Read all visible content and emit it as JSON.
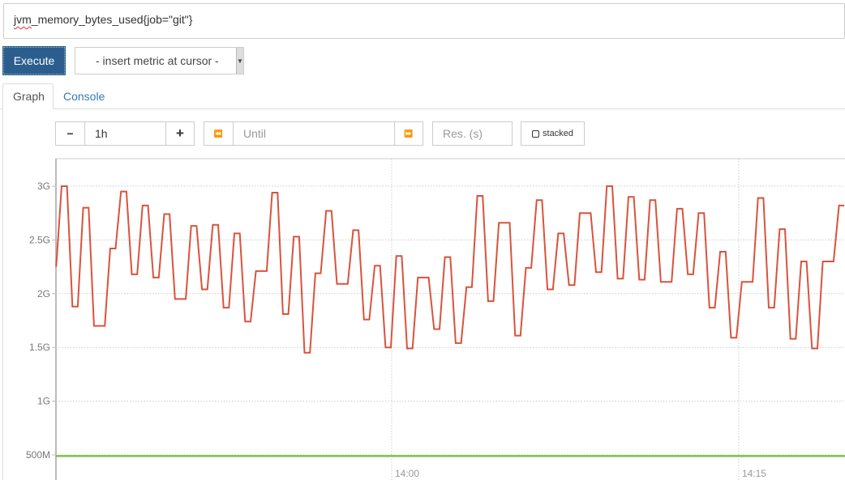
{
  "query": {
    "prefix": "jvm",
    "rest": "_memory_bytes_used{job=\"git\"}"
  },
  "toolbar": {
    "execute_label": "Execute",
    "metric_select": "- insert metric at cursor -"
  },
  "tabs": [
    {
      "label": "Graph",
      "active": true
    },
    {
      "label": "Console",
      "active": false
    }
  ],
  "controls": {
    "minus": "−",
    "range": "1h",
    "plus": "+",
    "rewind_icon": "⏪",
    "until_placeholder": "Until",
    "forward_icon": "⏩",
    "res_placeholder": "Res. (s)",
    "stacked_label": "stacked"
  },
  "colors": {
    "series_red": "#d9533c",
    "series_green": "#7dc24b",
    "accent": "#2c5d8f"
  },
  "chart_data": {
    "type": "line",
    "ylabel": "",
    "xlabel": "",
    "y_ticks": [
      {
        "value": 0.5,
        "label": "500M"
      },
      {
        "value": 1,
        "label": "1G"
      },
      {
        "value": 1.5,
        "label": "1.5G"
      },
      {
        "value": 2,
        "label": "2G"
      },
      {
        "value": 2.5,
        "label": "2.5G"
      },
      {
        "value": 3,
        "label": "3G"
      }
    ],
    "x_ticks": [
      {
        "minutes": 0,
        "label": "14:00"
      },
      {
        "minutes": 15,
        "label": "14:15"
      }
    ],
    "ylim_G": [
      0.27,
      3.25
    ],
    "xlim_minutes_from_1400": [
      -14.5,
      19.6
    ],
    "grid": true,
    "series": [
      {
        "name": "jvm_memory_bytes_used (red)",
        "color": "#d9533c",
        "start_minutes_from_1400": -14.5,
        "step_seconds": 14,
        "unit": "G",
        "values": [
          2.25,
          3.0,
          3.0,
          1.88,
          1.88,
          2.8,
          2.8,
          1.7,
          1.7,
          1.7,
          2.42,
          2.42,
          2.95,
          2.95,
          2.18,
          2.18,
          2.82,
          2.82,
          2.15,
          2.15,
          2.74,
          2.74,
          1.95,
          1.95,
          1.95,
          2.63,
          2.63,
          2.04,
          2.04,
          2.64,
          2.64,
          1.87,
          1.87,
          2.56,
          2.56,
          1.74,
          1.74,
          2.21,
          2.21,
          2.21,
          2.94,
          2.94,
          1.81,
          1.81,
          2.53,
          2.53,
          1.45,
          1.45,
          2.19,
          2.19,
          2.77,
          2.77,
          2.09,
          2.09,
          2.09,
          2.59,
          2.59,
          1.76,
          1.76,
          2.26,
          2.26,
          1.5,
          1.5,
          2.35,
          2.35,
          1.49,
          1.49,
          2.15,
          2.15,
          2.15,
          1.67,
          1.67,
          2.34,
          2.34,
          1.54,
          1.54,
          2.06,
          2.06,
          2.91,
          2.91,
          1.93,
          1.93,
          2.66,
          2.66,
          2.66,
          1.61,
          1.61,
          2.24,
          2.24,
          2.87,
          2.87,
          2.04,
          2.04,
          2.56,
          2.56,
          2.08,
          2.08,
          2.75,
          2.75,
          2.75,
          2.2,
          2.2,
          3.0,
          3.0,
          2.14,
          2.14,
          2.9,
          2.9,
          2.13,
          2.13,
          2.87,
          2.87,
          2.11,
          2.11,
          2.11,
          2.79,
          2.79,
          2.18,
          2.18,
          2.75,
          2.75,
          1.87,
          1.87,
          2.39,
          2.39,
          1.59,
          1.59,
          2.11,
          2.11,
          2.11,
          2.89,
          2.89,
          1.87,
          1.87,
          2.6,
          2.6,
          1.58,
          1.58,
          2.3,
          2.3,
          1.49,
          1.49,
          2.3,
          2.3,
          2.3,
          2.82,
          2.82
        ]
      },
      {
        "name": "jvm_memory_bytes_used (green)",
        "color": "#7dc24b",
        "constant_G": 0.49
      }
    ]
  }
}
